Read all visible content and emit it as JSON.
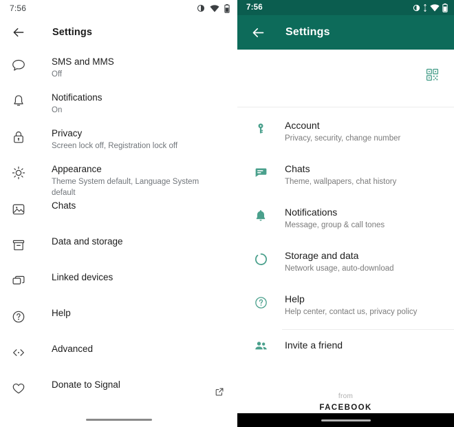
{
  "left_panel": {
    "app": "signal-settings",
    "status_bar": {
      "clock": "7:56",
      "icons": [
        "contrast-icon",
        "wifi-icon",
        "battery-icon"
      ]
    },
    "appbar": {
      "back_icon": "arrow-back-icon",
      "title": "Settings"
    },
    "items": [
      {
        "icon": "chat-bubble-icon",
        "title": "SMS and MMS",
        "subtitle": "Off"
      },
      {
        "icon": "bell-icon",
        "title": "Notifications",
        "subtitle": "On"
      },
      {
        "icon": "lock-icon",
        "title": "Privacy",
        "subtitle": "Screen lock off, Registration lock off"
      },
      {
        "icon": "brightness-icon",
        "title": "Appearance",
        "subtitle": "Theme System default, Language System default"
      },
      {
        "icon": "image-icon",
        "title": "Chats",
        "subtitle": ""
      },
      {
        "icon": "archive-box-icon",
        "title": "Data and storage",
        "subtitle": ""
      },
      {
        "icon": "linked-devices-icon",
        "title": "Linked devices",
        "subtitle": ""
      },
      {
        "icon": "help-circle-icon",
        "title": "Help",
        "subtitle": ""
      },
      {
        "icon": "code-brackets-icon",
        "title": "Advanced",
        "subtitle": ""
      },
      {
        "icon": "heart-icon",
        "title": "Donate to Signal",
        "subtitle": "",
        "trailing_icon": "external-link-icon"
      }
    ],
    "nav_bar": {
      "handle": "home-gesture-pill"
    }
  },
  "right_panel": {
    "app": "whatsapp-settings",
    "colors": {
      "status_bar": "#0b5d4f",
      "app_bar": "#0d6b5a",
      "accent": "#4aa08c"
    },
    "status_bar": {
      "clock": "7:56",
      "icons": [
        "contrast-icon",
        "data-transfer-icon",
        "wifi-icon",
        "battery-icon"
      ]
    },
    "appbar": {
      "back_icon": "arrow-back-icon",
      "title": "Settings"
    },
    "profile": {
      "qr_icon": "qr-code-icon"
    },
    "items": [
      {
        "icon": "key-icon",
        "title": "Account",
        "subtitle": "Privacy, security, change number"
      },
      {
        "icon": "chat-icon",
        "title": "Chats",
        "subtitle": "Theme, wallpapers, chat history"
      },
      {
        "icon": "bell-icon",
        "title": "Notifications",
        "subtitle": "Message, group & call tones"
      },
      {
        "icon": "storage-ring-icon",
        "title": "Storage and data",
        "subtitle": "Network usage, auto-download"
      },
      {
        "icon": "help-circle-icon",
        "title": "Help",
        "subtitle": "Help center, contact us, privacy policy"
      }
    ],
    "invite": {
      "icon": "people-icon",
      "title": "Invite a friend"
    },
    "footer": {
      "from": "from",
      "brand": "FACEBOOK"
    },
    "nav_bar": {
      "handle": "home-gesture-pill"
    }
  }
}
